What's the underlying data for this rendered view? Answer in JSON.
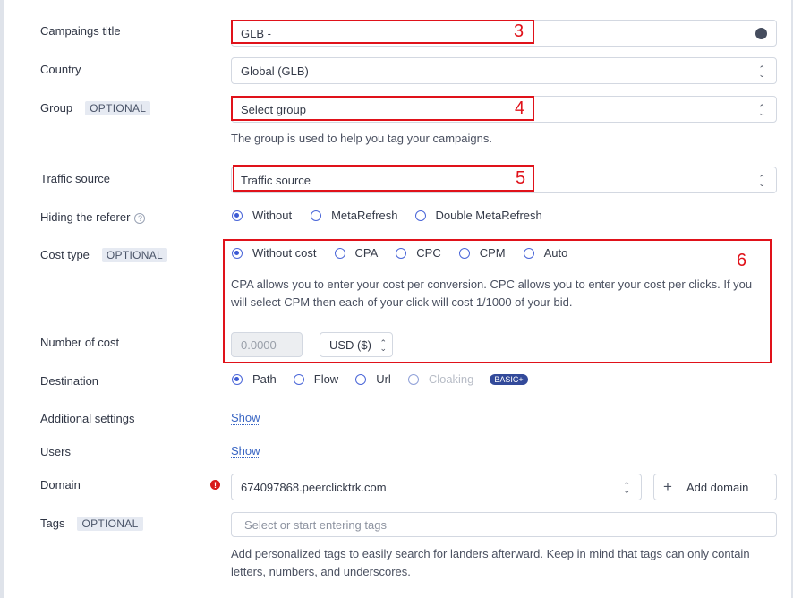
{
  "labels": {
    "campaigns_title": "Campaings title",
    "country": "Country",
    "group": "Group",
    "traffic_source": "Traffic source",
    "hiding_referer": "Hiding the referer",
    "cost_type": "Cost type",
    "number_of_cost": "Number of cost",
    "destination": "Destination",
    "additional_settings": "Additional settings",
    "users": "Users",
    "domain": "Domain",
    "tags": "Tags"
  },
  "optional_badge": "OPTIONAL",
  "fields": {
    "title_value": "GLB -",
    "country_value": "Global (GLB)",
    "group_placeholder": "Select group",
    "group_help": "The group is used to help you tag your campaigns.",
    "traffic_source_placeholder": "Traffic source",
    "cost_value_placeholder": "0.0000",
    "currency_value": "USD ($)",
    "domain_value": "674097868.peerclicktrk.com",
    "tags_placeholder": "Select or start entering tags",
    "tags_help": "Add personalized tags to easily search for landers afterward. Keep in mind that tags can only contain letters, numbers, and underscores."
  },
  "referer_options": [
    "Without",
    "MetaRefresh",
    "Double MetaRefresh"
  ],
  "referer_selected": "Without",
  "cost_options": [
    "Without cost",
    "CPA",
    "CPC",
    "CPM",
    "Auto"
  ],
  "cost_selected": "Without cost",
  "cost_help": "CPA allows you to enter your cost per conversion. CPC allows you to enter your cost per clicks. If you will select CPM then each of your click will cost 1/1000 of your bid.",
  "destination_options": [
    "Path",
    "Flow",
    "Url",
    "Cloaking"
  ],
  "destination_selected": "Path",
  "destination_badge": "BASIC+",
  "show_link": "Show",
  "add_domain": "Add domain",
  "annotations": [
    "3",
    "4",
    "5",
    "6"
  ],
  "colors": {
    "annotation": "#e0121a",
    "accent": "#3c5ad4",
    "badge_bg": "#e6eaf2"
  }
}
